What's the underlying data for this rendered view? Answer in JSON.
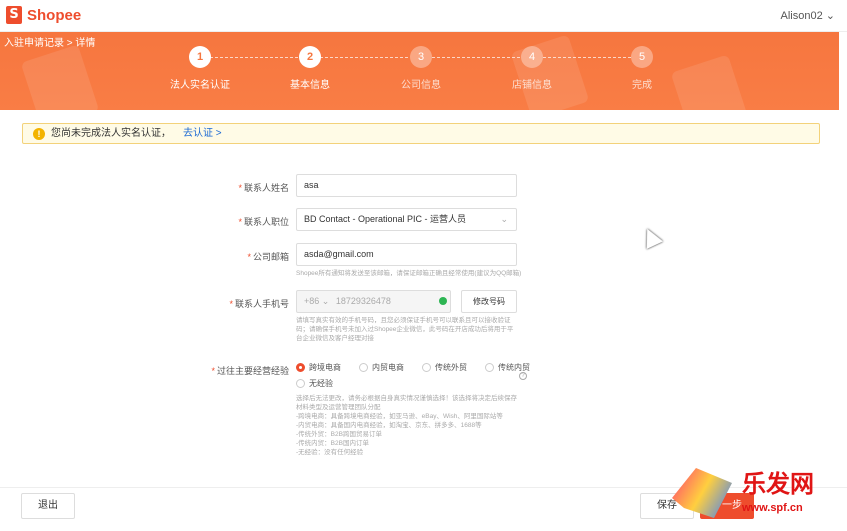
{
  "header": {
    "brand": "Shopee",
    "user": "Alison02"
  },
  "banner": {
    "breadcrumb": "入驻申请记录 > 详情"
  },
  "steps": [
    {
      "num": "1",
      "label": "法人实名认证",
      "active": true
    },
    {
      "num": "2",
      "label": "基本信息",
      "active": true
    },
    {
      "num": "3",
      "label": "公司信息",
      "active": false
    },
    {
      "num": "4",
      "label": "店铺信息",
      "active": false
    },
    {
      "num": "5",
      "label": "完成",
      "active": false
    }
  ],
  "notice": {
    "text": "您尚未完成法人实名认证，",
    "link": "去认证 >"
  },
  "form": {
    "contact_name_label": "联系人姓名",
    "contact_name_value": "asa",
    "position_label": "联系人职位",
    "position_value": "BD Contact - Operational PIC - 运营人员",
    "email_label": "公司邮箱",
    "email_value": "asda@gmail.com",
    "email_hint": "Shopee所有通知将发送至该邮箱，请保证邮箱正确且经常使用(建议为QQ邮箱)",
    "phone_label": "联系人手机号",
    "phone_prefix": "+86",
    "phone_value": "18729326478",
    "phone_button": "修改号码",
    "phone_hint": "请填写真实有效的手机号码，且您必须保证手机号可以联系且可以接收验证码；请确保手机号未加入过Shopee企业微信，此号码在开店成功后将用于平台企业微信及客户经理对接",
    "experience_label": "过往主要经营经验",
    "experience_options": [
      "跨境电商",
      "内贸电商",
      "传统外贸",
      "传统内贸",
      "无经验"
    ],
    "experience_hint": "选择后无法更改，请务必根据自身真实情况谨慎选择！该选择将决定后续保存材料类型及运营管理团队分配\n-跨境电商：具备跨境电商经验，如亚马逊、eBay、Wish、阿里国际站等\n-内贸电商：具备国内电商经验，如淘宝、京东、拼多多、1688等\n-传统外贸：B2B跨国贸易订单\n-传统内贸：B2B国内订单\n-无经验：没有任何经验"
  },
  "footer": {
    "exit": "退出",
    "save": "保存",
    "next": "下一步"
  },
  "watermark": {
    "title": "乐发网",
    "url": "www.spf.cn"
  },
  "colors": {
    "brand": "#ee4d2d",
    "banner": "#f6763f",
    "link": "#1b69d4"
  }
}
